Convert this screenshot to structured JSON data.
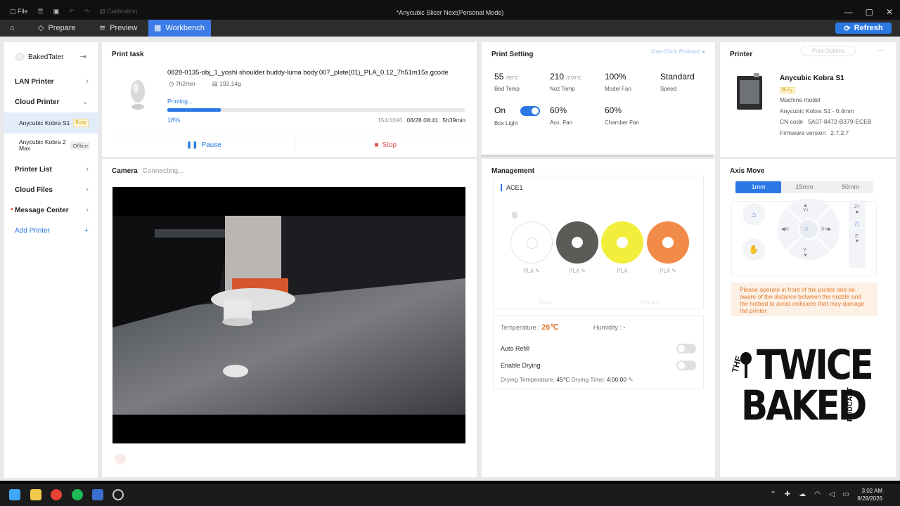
{
  "titlebar": {
    "file_label": "File",
    "calibration_label": "Calibration",
    "title": "*Anycubic Slicer Next(Personal Mode)"
  },
  "tabs": [
    {
      "label": "Prepare"
    },
    {
      "label": "Preview"
    },
    {
      "label": "Workbench"
    }
  ],
  "refresh_label": "Refresh",
  "sidebar": {
    "username": "BakedTater",
    "lan_printer": "LAN Printer",
    "cloud_printer": "Cloud Printer",
    "printers": [
      {
        "name": "Anycubic Kobra S1",
        "status": "Busy"
      },
      {
        "name": "Anycubic Kobra 2 Max",
        "status": "Offline"
      }
    ],
    "printer_list": "Printer List",
    "cloud_files": "Cloud Files",
    "message_center": "Message Center",
    "add_printer": "Add Printer",
    "add_icon": "+"
  },
  "print_task": {
    "title": "Print task",
    "filename": "0828-0135-obj_1_yoshi shoulder buddy-luma body.007_plate(01)_PLA_0.12_7h51m15s.gcode",
    "duration": "7h2min",
    "weight": "192.14g",
    "status": "Printing...",
    "progress": 0.18,
    "percent": "18%",
    "layers": "154/1696",
    "timestamp": "08/28 08:41",
    "remaining": "5h39min",
    "pause_label": "Pause",
    "stop_label": "Stop"
  },
  "camera": {
    "title": "Camera",
    "status": "Connecting..."
  },
  "print_setting": {
    "title": "Print Setting",
    "preheat_label": "One-Click Preheat",
    "bed_temp": "55",
    "bed_target": "/55°C",
    "bed_label": "Bed Temp",
    "noz_temp": "210",
    "noz_target": "/210°C",
    "noz_label": "Noz Temp",
    "model_fan": "100%",
    "model_fan_label": "Model Fan",
    "speed": "Standard",
    "speed_label": "Speed",
    "box_light": "On",
    "box_light_label": "Box Light",
    "aux_fan": "60%",
    "aux_fan_label": "Aux. Fan",
    "chamber_fan": "60%",
    "chamber_fan_label": "Chamber Fan"
  },
  "printer": {
    "title": "Printer",
    "options_label": "Print Options",
    "more": "···",
    "name": "Anycubic Kobra S1",
    "status": "Busy",
    "machine_model_label": "Machine model",
    "machine_model": "Anycubic Kobra S1 - 0.4mm",
    "cn_label": "CN code",
    "cn_code": "5A07-8472-B379-ECEB",
    "fw_label": "Firmware version",
    "fw_version": "2.7.2.7"
  },
  "management": {
    "title": "Management",
    "ace": "ACE1",
    "slots": [
      {
        "material": "PLA",
        "color": "#ffffff"
      },
      {
        "material": "PLA",
        "color": "#5b5b57"
      },
      {
        "material": "PLA",
        "color": "#f2ee3c"
      },
      {
        "material": "PLA",
        "color": "#f28a4a"
      }
    ],
    "feed_label": "Feed",
    "retract_label": "Retract",
    "temperature_label": "Temperature :",
    "temperature": "26℃",
    "humidity_label": "Humidity :",
    "humidity": "-",
    "auto_refill_label": "Auto Refill",
    "auto_refill": false,
    "enable_drying_label": "Enable Drying",
    "enable_drying": false,
    "drying_temp_label": "Drying Temperature:",
    "drying_temp": "45℃",
    "drying_time_label": "Drying Time:",
    "drying_time": "4:00:00"
  },
  "axis": {
    "title": "Axis Move",
    "steps": [
      "1mm",
      "15mm",
      "50mm"
    ],
    "selected_step": "1mm",
    "y_plus": "Y+",
    "y_minus": "Y-",
    "x_plus": "X+",
    "x_minus": "X-",
    "z_plus": "Z+",
    "z_minus": "Z-",
    "warning": "Please operate in front of the printer and be aware of the distance between the nozzle and the hotbed to avoid collisions that may damage the printer"
  },
  "logo": {
    "line1": "THE",
    "line2": "TWICE",
    "line3": "BAKED",
    "line4": "PODCAST"
  },
  "taskbar": {
    "time": "3:02 AM",
    "date": "8/28/2026"
  }
}
